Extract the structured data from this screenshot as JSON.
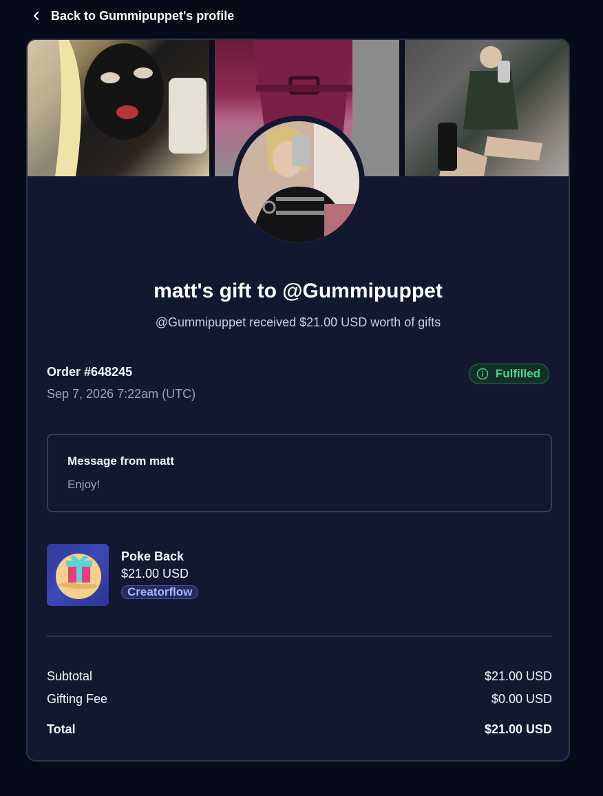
{
  "nav": {
    "back_label": "Back to Gummipuppet's profile"
  },
  "header": {
    "title": "matt's gift to @Gummipuppet",
    "subtitle": "@Gummipuppet received $21.00 USD worth of gifts"
  },
  "order": {
    "number": "Order #648245",
    "date": "Sep 7, 2026 7:22am (UTC)",
    "status": "Fulfilled"
  },
  "message": {
    "title": "Message from matt",
    "text": "Enjoy!"
  },
  "product": {
    "name": "Poke Back",
    "price": "$21.00 USD",
    "badge": "Creatorflow"
  },
  "summary": {
    "subtotal_label": "Subtotal",
    "subtotal_value": "$21.00 USD",
    "fee_label": "Gifting Fee",
    "fee_value": "$0.00 USD",
    "total_label": "Total",
    "total_value": "$21.00 USD"
  },
  "colors": {
    "background": "#070a19",
    "card": "#121830",
    "status_green": "#4ed58a",
    "badge_text": "#a8b4ff"
  },
  "icons": [
    "chevron-left-icon",
    "info-circle-icon",
    "gift-icon"
  ]
}
